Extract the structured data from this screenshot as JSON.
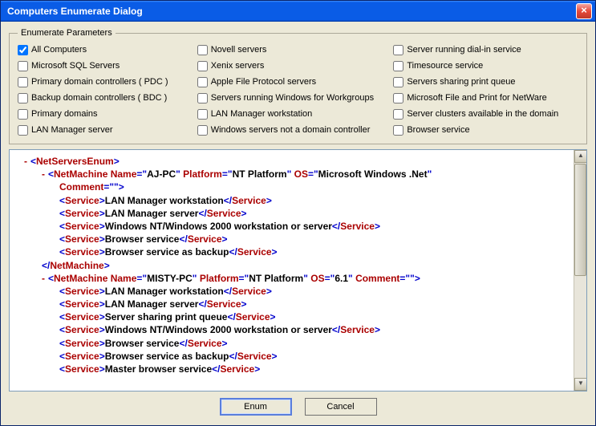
{
  "title": "Computers Enumerate Dialog",
  "fieldset_legend": "Enumerate Parameters",
  "checkboxes": [
    {
      "label": "All Computers",
      "checked": true
    },
    {
      "label": "Novell servers",
      "checked": false
    },
    {
      "label": "Server running dial-in service",
      "checked": false
    },
    {
      "label": "Microsoft SQL Servers",
      "checked": false
    },
    {
      "label": "Xenix servers",
      "checked": false
    },
    {
      "label": "Timesource service",
      "checked": false
    },
    {
      "label": "Primary domain controllers ( PDC )",
      "checked": false
    },
    {
      "label": "Apple File Protocol servers",
      "checked": false
    },
    {
      "label": "Servers sharing print queue",
      "checked": false
    },
    {
      "label": "Backup domain controllers ( BDC )",
      "checked": false
    },
    {
      "label": "Servers running Windows for Workgroups",
      "checked": false
    },
    {
      "label": "Microsoft File and Print for NetWare",
      "checked": false
    },
    {
      "label": "Primary domains",
      "checked": false
    },
    {
      "label": "LAN Manager workstation",
      "checked": false
    },
    {
      "label": "Server clusters available in the domain",
      "checked": false
    },
    {
      "label": "LAN Manager server",
      "checked": false
    },
    {
      "label": "Windows servers not a domain controller",
      "checked": false
    },
    {
      "label": "Browser service",
      "checked": false
    }
  ],
  "xml": {
    "root": "NetServersEnum",
    "machines": [
      {
        "tag": "NetMachine",
        "attrs": {
          "Name": "AJ-PC",
          "Platform": "NT Platform",
          "OS": "Microsoft Windows .Net",
          "Comment": ""
        },
        "services": [
          "LAN Manager workstation",
          "LAN Manager server",
          "Windows NT/Windows 2000 workstation or server",
          "Browser service",
          "Browser service as backup"
        ]
      },
      {
        "tag": "NetMachine",
        "attrs": {
          "Name": "MISTY-PC",
          "Platform": "NT Platform",
          "OS": "6.1",
          "Comment": ""
        },
        "services": [
          "LAN Manager workstation",
          "LAN Manager server",
          "Server sharing print queue",
          "Windows NT/Windows 2000 workstation or server",
          "Browser service",
          "Browser service as backup",
          "Master browser service"
        ],
        "truncated_last": true
      }
    ]
  },
  "service_tag": "Service",
  "buttons": {
    "enum": "Enum",
    "cancel": "Cancel"
  }
}
